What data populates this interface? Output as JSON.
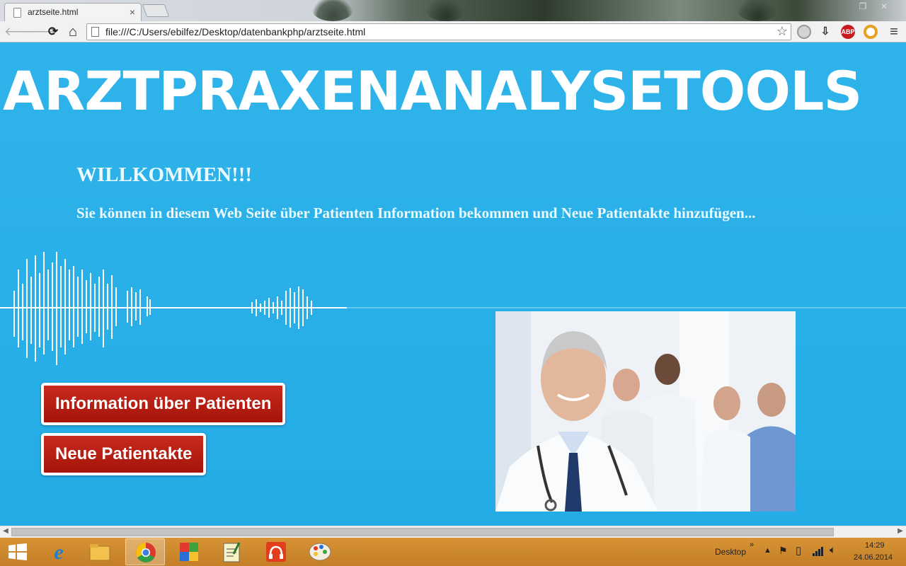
{
  "browser": {
    "tab_title": "arztseite.html",
    "tab_close": "×",
    "url": "file:///C:/Users/ebilfez/Desktop/datenbankphp/arztseite.html",
    "back": "🡐",
    "forward": "🡒",
    "reload": "⟳",
    "home": "⌂",
    "star": "☆",
    "menu": "≡",
    "extensions": {
      "abp": "ABP"
    }
  },
  "page": {
    "title": "ARZTPRAXENANALYSETOOLS",
    "welcome": "WILLKOMMEN!!!",
    "description": "Sie können in diesem Web Seite über Patienten Information bekommen und Neue Patientakte hinzufügen...",
    "buttons": {
      "patient_info": "Information über Patienten",
      "new_record": "Neue Patientakte"
    },
    "accent_color": "#29aee8",
    "button_color": "#b81e13"
  },
  "taskbar": {
    "tray_label": "Desktop",
    "tray_chevron": "»",
    "time": "14:29",
    "date": "24.06.2014"
  }
}
